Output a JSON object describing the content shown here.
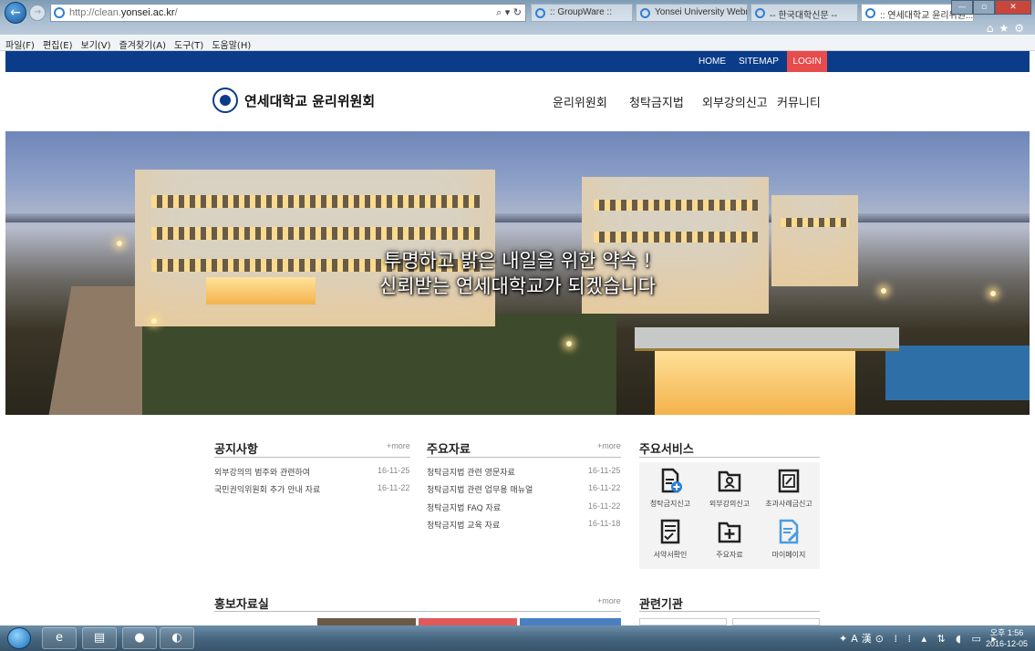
{
  "browser": {
    "url_prefix": "http://clean.",
    "url_domain": "yonsei.ac.kr",
    "url_suffix": "/",
    "addr_controls": "⌕ ▾ ↻",
    "tabs": [
      {
        "label": ":: GroupWare ::"
      },
      {
        "label": "Yonsei University Webmail"
      },
      {
        "label": "-- 한국대학신문 --"
      },
      {
        "label": ":: 연세대학교 윤리위원..."
      }
    ],
    "menu": [
      "파일(F)",
      "편집(E)",
      "보기(V)",
      "즐겨찾기(A)",
      "도구(T)",
      "도움말(H)"
    ]
  },
  "topbar": {
    "home": "HOME",
    "sitemap": "SITEMAP",
    "login": "LOGIN",
    "login_color": "#e84b4b",
    "bar_color": "#0b3c89"
  },
  "header": {
    "logo_text": "연세대학교 윤리위원회",
    "nav": [
      "윤리위원회",
      "청탁금지법",
      "외부강의신고",
      "커뮤니티"
    ]
  },
  "hero": {
    "line1": "투명하고 밝은 내일을 위한 약속 !",
    "line2": "신뢰받는 연세대학교가 되겠습니다"
  },
  "notices": {
    "title": "공지사항",
    "more": "+more",
    "items": [
      {
        "title": "외부강의의 범주와 관련하여",
        "date": "16-11-25"
      },
      {
        "title": "국민권익위원회 추가 안내 자료",
        "date": "16-11-22"
      }
    ]
  },
  "resources": {
    "title": "주요자료",
    "more": "+more",
    "items": [
      {
        "title": "청탁금지법 관련 영문자료",
        "date": "16-11-25"
      },
      {
        "title": "청탁금지법 관련 업무용 매뉴얼",
        "date": "16-11-22"
      },
      {
        "title": "청탁금지법 FAQ 자료",
        "date": "16-11-22"
      },
      {
        "title": "청탁금지법 교육 자료",
        "date": "16-11-18"
      }
    ]
  },
  "services": {
    "title": "주요서비스",
    "items": [
      {
        "label": "청탁금지신고",
        "icon": "report-plus-icon"
      },
      {
        "label": "외부강의신고",
        "icon": "folder-person-icon"
      },
      {
        "label": "초과사례금신고",
        "icon": "clipboard-edit-icon"
      },
      {
        "label": "서약서확인",
        "icon": "checklist-icon"
      },
      {
        "label": "주요자료",
        "icon": "folder-plus-icon"
      },
      {
        "label": "마이페이지",
        "icon": "document-pen-icon"
      }
    ]
  },
  "promo": {
    "title": "홍보자료실",
    "more": "+more"
  },
  "related": {
    "title": "관련기관"
  },
  "taskbar": {
    "tray": "✦A漢⊙ ⁞ ⁞ ▴ ⇅ ◖ ▭ ▸",
    "time": "오후 1:56",
    "date": "2016-12-05"
  }
}
